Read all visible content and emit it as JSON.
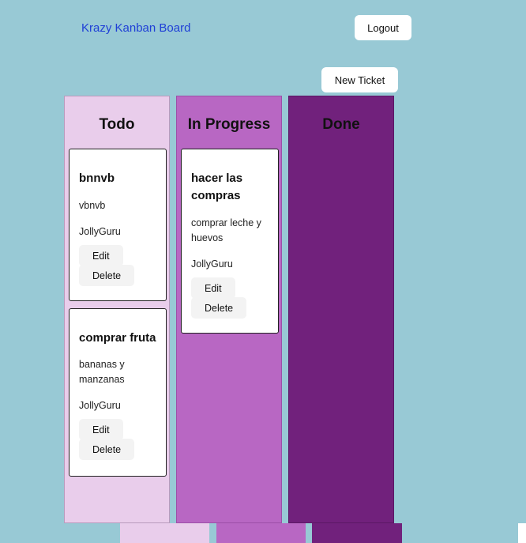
{
  "header": {
    "brand": "Krazy Kanban Board",
    "logout_label": "Logout"
  },
  "toolbar": {
    "new_ticket_label": "New Ticket"
  },
  "columns": [
    {
      "title": "Todo",
      "color": "#e9cdeb",
      "cards": [
        {
          "title": "bnnvb",
          "description": "vbnvb",
          "user": "JollyGuru",
          "edit_label": "Edit",
          "delete_label": "Delete"
        },
        {
          "title": "comprar fruta",
          "description": "bananas y manzanas",
          "user": "JollyGuru",
          "edit_label": "Edit",
          "delete_label": "Delete"
        }
      ]
    },
    {
      "title": "In Progress",
      "color": "#b867c3",
      "cards": [
        {
          "title": "hacer las compras",
          "description": "comprar leche y huevos",
          "user": "JollyGuru",
          "edit_label": "Edit",
          "delete_label": "Delete"
        }
      ]
    },
    {
      "title": "Done",
      "color": "#71217c",
      "cards": []
    }
  ]
}
